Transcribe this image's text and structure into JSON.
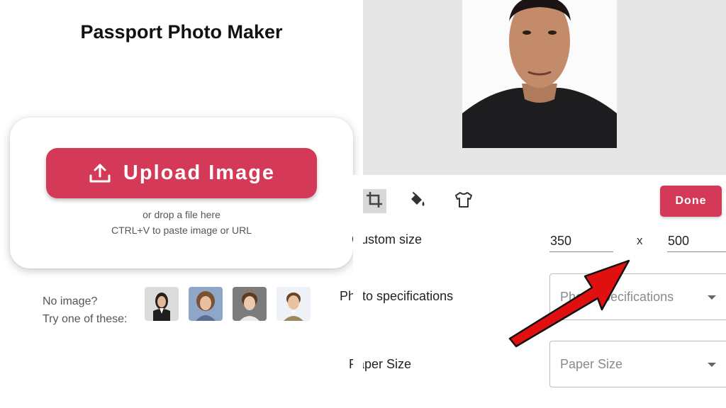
{
  "app": {
    "title": "Passport Photo Maker"
  },
  "upload": {
    "button_label": "Upload Image",
    "drop_text": "or drop a file here",
    "paste_text": "CTRL+V to paste image or URL"
  },
  "samples": {
    "prompt_line1": "No image?",
    "prompt_line2": "Try one of these:"
  },
  "editor": {
    "toolbar": {
      "tools": [
        {
          "icon": "crop-icon",
          "active": true
        },
        {
          "icon": "paint-bucket-icon",
          "active": false
        },
        {
          "icon": "tshirt-icon",
          "active": false
        }
      ],
      "done_label": "Done"
    },
    "custom_size": {
      "label": "Custom size",
      "width": "350",
      "times": "x",
      "height": "500"
    },
    "photo_spec": {
      "label": "Photo specifications",
      "placeholder": "Photo specifications"
    },
    "paper_size": {
      "label": "Paper Size",
      "placeholder": "Paper Size"
    }
  },
  "colors": {
    "accent": "#d43a58",
    "preview_bg": "#e6e6e6",
    "annotation_arrow": "#e01010"
  }
}
